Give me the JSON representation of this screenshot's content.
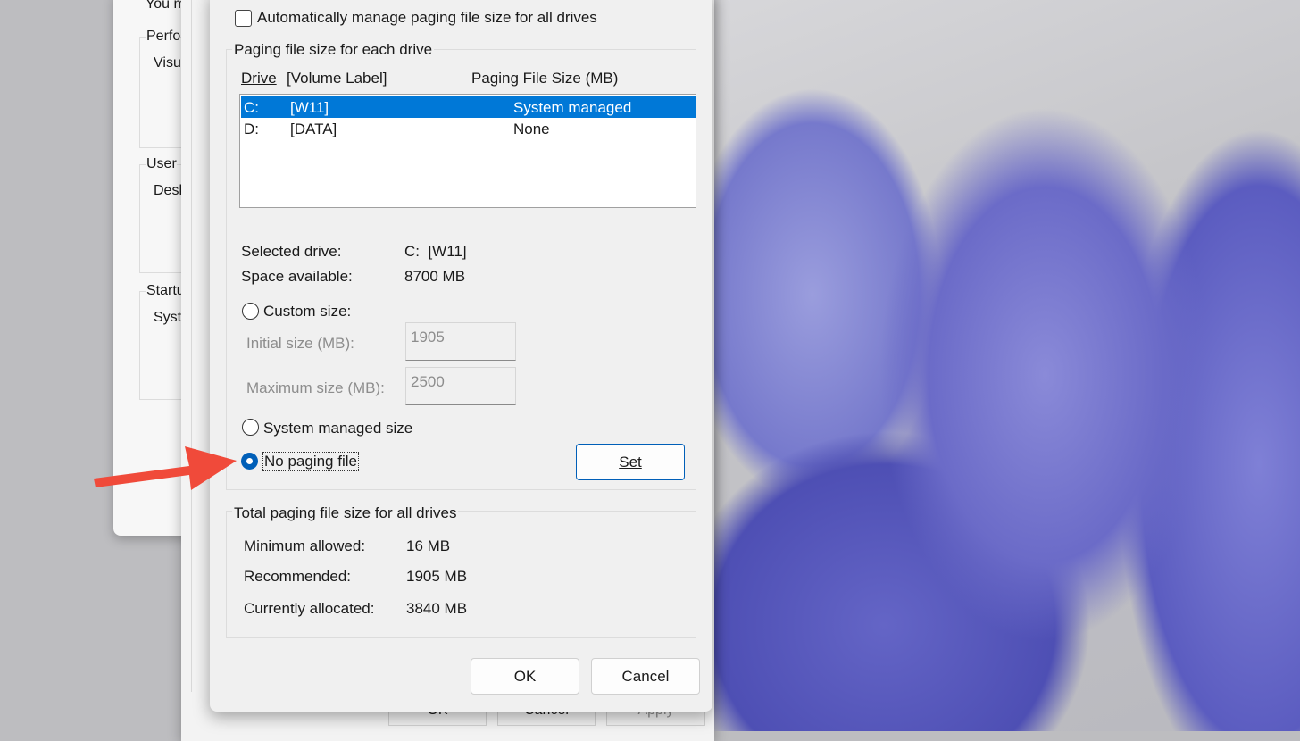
{
  "background_window": {
    "fragments": [
      "You m",
      "Perfo",
      "Visu",
      "User",
      "Desk",
      "Startu",
      "Syst"
    ],
    "buttons": {
      "ok": "OK",
      "cancel": "Cancel",
      "apply": "Apply"
    }
  },
  "dialog": {
    "auto_manage_label": "Automatically manage paging file size for all drives",
    "auto_manage_checked": false,
    "group1_title": "Paging file size for each drive",
    "columns": {
      "drive": "Drive",
      "volume": "[Volume Label]",
      "size": "Paging File Size (MB)"
    },
    "drives": [
      {
        "drive": "C:",
        "label": "[W11]",
        "size": "System managed",
        "selected": true
      },
      {
        "drive": "D:",
        "label": "[DATA]",
        "size": "None",
        "selected": false
      }
    ],
    "selected_drive_label": "Selected drive:",
    "selected_drive_value": "C:  [W11]",
    "space_available_label": "Space available:",
    "space_available_value": "8700 MB",
    "custom_size_label": "Custom size:",
    "initial_size_label": "Initial size (MB):",
    "initial_size_value": "1905",
    "maximum_size_label": "Maximum size (MB):",
    "maximum_size_value": "2500",
    "system_managed_label": "System managed size",
    "no_paging_label": "No paging file",
    "selected_option": "No paging file",
    "set_button": "Set",
    "group2_title": "Total paging file size for all drives",
    "minimum_label": "Minimum allowed:",
    "minimum_value": "16 MB",
    "recommended_label": "Recommended:",
    "recommended_value": "1905 MB",
    "allocated_label": "Currently allocated:",
    "allocated_value": "3840 MB",
    "ok_button": "OK",
    "cancel_button": "Cancel"
  },
  "colors": {
    "selection": "#0078d7",
    "arrow": "#f04a3a",
    "radio": "#005fb8"
  }
}
